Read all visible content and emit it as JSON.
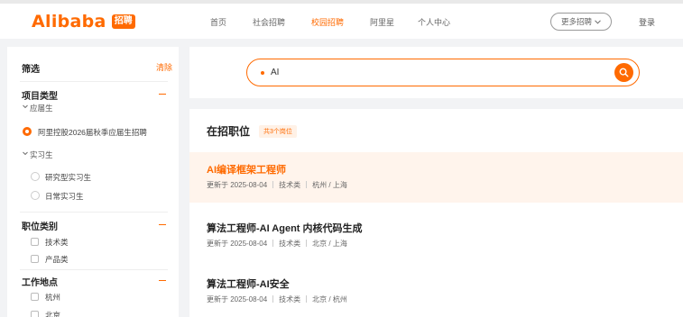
{
  "header": {
    "logo_text": "Alibaba",
    "logo_badge": "招聘",
    "nav": [
      {
        "label": "首页",
        "active": false
      },
      {
        "label": "社会招聘",
        "active": false
      },
      {
        "label": "校园招聘",
        "active": true
      },
      {
        "label": "阿里星",
        "active": false
      },
      {
        "label": "个人中心",
        "active": false
      }
    ],
    "more_label": "更多招聘",
    "login_label": "登录"
  },
  "sidebar": {
    "title": "筛选",
    "clear_label": "清除",
    "project_type": {
      "title": "项目类型",
      "groups": [
        {
          "label": "应届生",
          "options": [
            {
              "label": "阿里控股2026届秋季应届生招聘",
              "selected": true
            }
          ]
        },
        {
          "label": "实习生",
          "options": [
            {
              "label": "研究型实习生",
              "selected": false
            },
            {
              "label": "日常实习生",
              "selected": false
            }
          ]
        }
      ]
    },
    "job_category": {
      "title": "职位类别",
      "options": [
        {
          "label": "技术类",
          "checked": false
        },
        {
          "label": "产品类",
          "checked": false
        }
      ]
    },
    "location": {
      "title": "工作地点",
      "options": [
        {
          "label": "杭州",
          "checked": false
        },
        {
          "label": "北京",
          "checked": false
        }
      ]
    }
  },
  "search": {
    "value": "AI",
    "icon": "search-icon"
  },
  "jobs": {
    "title": "在招职位",
    "count": "共3个岗位",
    "items": [
      {
        "title": "AI编译框架工程师",
        "updated": "更新于 2025-08-04",
        "category": "技术类",
        "location": "杭州 / 上海",
        "highlighted": true
      },
      {
        "title": "算法工程师-AI Agent 内核代码生成",
        "updated": "更新于 2025-08-04",
        "category": "技术类",
        "location": "北京 / 上海",
        "highlighted": false
      },
      {
        "title": "算法工程师-AI安全",
        "updated": "更新于 2025-08-04",
        "category": "技术类",
        "location": "北京 / 杭州",
        "highlighted": false
      }
    ]
  },
  "colors": {
    "accent": "#ff6a00",
    "background": "#f2f3f5"
  }
}
